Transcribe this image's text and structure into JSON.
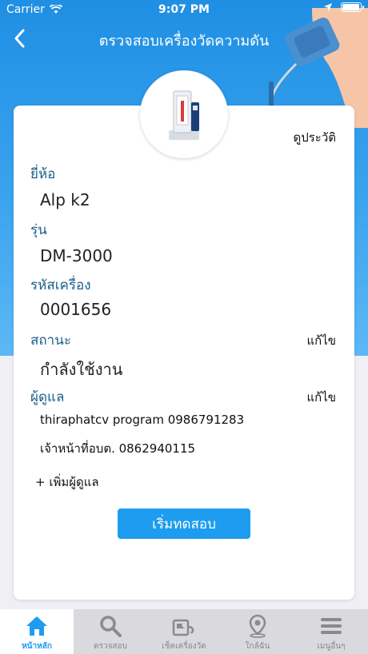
{
  "status_bar": {
    "carrier": "Carrier",
    "time": "9:07 PM"
  },
  "nav": {
    "title": "ตรวจสอบเครื่องวัดความดัน"
  },
  "card": {
    "history_link": "ดูประวัติ",
    "brand": {
      "label": "ยี่ห้อ",
      "value": "Alp k2"
    },
    "model": {
      "label": "รุ่น",
      "value": "DM-3000"
    },
    "serial": {
      "label": "รหัสเครื่อง",
      "value": "0001656"
    },
    "status": {
      "label": "สถานะ",
      "value": "กำลังใช้งาน",
      "edit": "แก้ไข"
    },
    "caretakers": {
      "label": "ผู้ดูแล",
      "edit": "แก้ไข",
      "items": [
        "thiraphatcv program  0986791283",
        "เจ้าหน้าที่อบต.  0862940115"
      ],
      "add": "+ เพิ่มผู้ดูแล"
    },
    "start_button": "เริ่มทดสอบ"
  },
  "tabs": [
    {
      "label": "หน้าหลัก",
      "icon": "home-icon",
      "active": true
    },
    {
      "label": "ตรวจสอบ",
      "icon": "search-icon",
      "active": false
    },
    {
      "label": "เช็คเครื่องวัด",
      "icon": "device-check-icon",
      "active": false
    },
    {
      "label": "ใกล้ฉัน",
      "icon": "location-pin-icon",
      "active": false
    },
    {
      "label": "เมนูอื่นๆ",
      "icon": "menu-icon",
      "active": false
    }
  ],
  "colors": {
    "primary": "#1d9cf0",
    "label_blue": "#1a5f8a",
    "tab_inactive": "#8a8a8a"
  }
}
